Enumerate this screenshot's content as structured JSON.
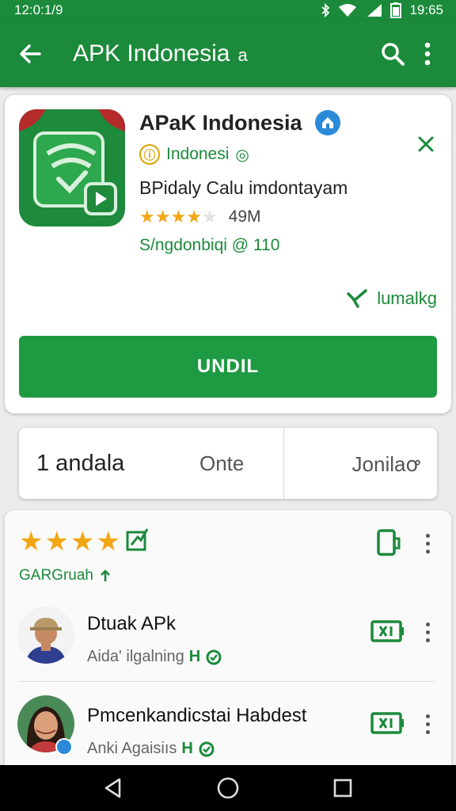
{
  "status_bar": {
    "time": "12:0:1/9",
    "clock": "19:65"
  },
  "app_bar": {
    "title": "APK Indonesia",
    "title_suffix": "a"
  },
  "app": {
    "name": "APaK Indonesia",
    "developer": "Indonesi",
    "tagline": "BPidaly Calu imdontayam",
    "rating": 4,
    "rating_max": 5,
    "size": "49M",
    "meta": "S/ngdonbiqi @ 110",
    "secondary_action": "lumalkg",
    "install_label": "UNDIL"
  },
  "info_strip": {
    "col1": "1 andala",
    "col2": "Onte",
    "col3": "Jonilaꝍ"
  },
  "reviews": {
    "stars": 4,
    "summary": "GARGruah",
    "items": [
      {
        "name": "Dtuak APk",
        "subtitle": "Aida' ilgalning",
        "badge": "H"
      },
      {
        "name": "Pmcenkandicstai Habdest",
        "subtitle": "Anki Agaisiıs",
        "badge": "H"
      }
    ]
  },
  "colors": {
    "primary": "#1b8a3a",
    "button": "#1e9a42",
    "star": "#f2a613",
    "verified": "#2a8ad8"
  },
  "icons": [
    "back-arrow-icon",
    "search-icon",
    "more-vert-icon",
    "verified-icon",
    "close-icon",
    "star-icon",
    "phone-icon",
    "battery-icon",
    "nav-back-icon",
    "nav-home-icon",
    "nav-recents-icon"
  ]
}
